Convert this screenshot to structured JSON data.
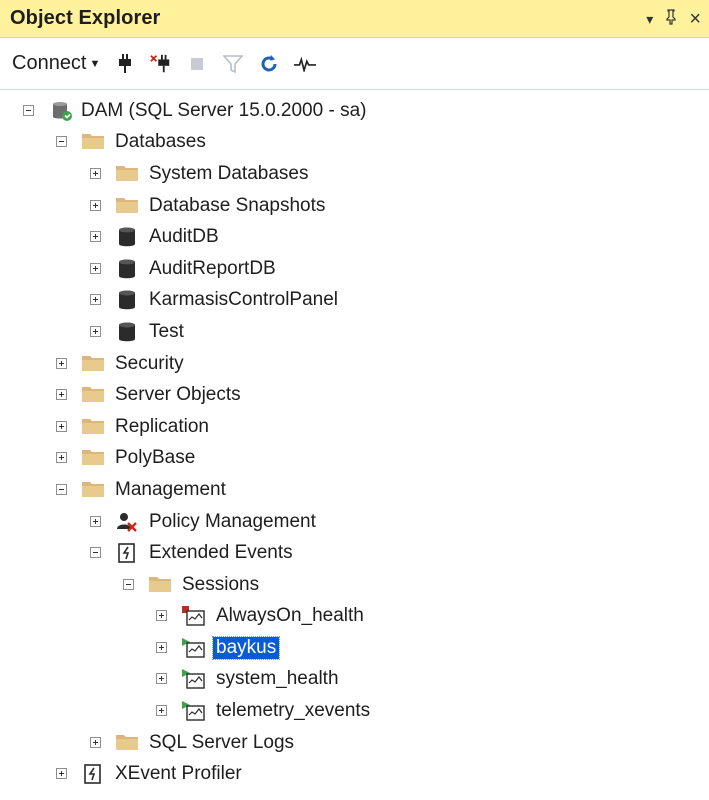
{
  "window": {
    "title": "Object Explorer",
    "buttons": {
      "dropdown": "▾",
      "pin": "ꟼ",
      "close": "×"
    }
  },
  "toolbar": {
    "connect_label": "Connect",
    "icons": [
      "connect-icon",
      "disconnect-icon",
      "stop-icon",
      "filter-icon",
      "refresh-icon",
      "activity-monitor-icon"
    ]
  },
  "tree": {
    "server": "DAM (SQL Server 15.0.2000 - sa)",
    "databases": "Databases",
    "system_databases": "System Databases",
    "database_snapshots": "Database Snapshots",
    "auditdb": "AuditDB",
    "auditreportdb": "AuditReportDB",
    "karmasis": "KarmasisControlPanel",
    "test": "Test",
    "security": "Security",
    "server_objects": "Server Objects",
    "replication": "Replication",
    "polybase": "PolyBase",
    "management": "Management",
    "policy_management": "Policy Management",
    "extended_events": "Extended Events",
    "sessions": "Sessions",
    "alwayson_health": "AlwaysOn_health",
    "baykus": "baykus",
    "system_health": "system_health",
    "telemetry_xevents": "telemetry_xevents",
    "sql_server_logs": "SQL Server Logs",
    "xevent_profiler": "XEvent Profiler"
  },
  "colors": {
    "title_bar": "#fff29d",
    "selection": "#0a5bd6",
    "folder": "#dcb67a",
    "session_running": "#3fa34d",
    "session_stopped": "#b52f25"
  }
}
